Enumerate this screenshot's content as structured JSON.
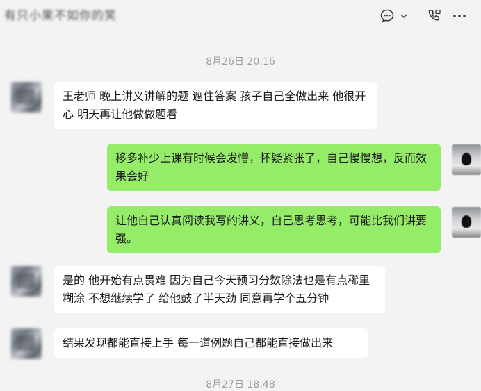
{
  "header": {
    "title": "有只小果不如你的笑",
    "icons": [
      "chat-bubble-icon",
      "chevron-down-icon",
      "phone-video-icon",
      "more-icon"
    ]
  },
  "messages": [
    {
      "type": "timestamp",
      "text": "8月26日 20:16"
    },
    {
      "type": "in",
      "text": "王老师 晚上讲义讲解的题 遮住答案 孩子自己全做出来 他很开心 明天再让他做做题看"
    },
    {
      "type": "out",
      "text": "移多补少上课有时候会发懵，怀疑紧张了，自己慢慢想，反而效果会好"
    },
    {
      "type": "out",
      "text": "让他自己认真阅读我写的讲义，自己思考思考，可能比我们讲要强。"
    },
    {
      "type": "in",
      "text": "是的 他开始有点畏难 因为自己今天预习分数除法也是有点稀里糊涂 不想继续学了 给他鼓了半天劲 同意再学个五分钟"
    },
    {
      "type": "in",
      "text": "结果发现都能直接上手 每一道例题自己都能直接做出来"
    },
    {
      "type": "timestamp",
      "text": "8月27日 18:48"
    }
  ],
  "colors": {
    "background": "#f3f3f3",
    "incoming": "#ffffff",
    "outgoing": "#95ec69",
    "timestamp": "#9e9e9e"
  }
}
